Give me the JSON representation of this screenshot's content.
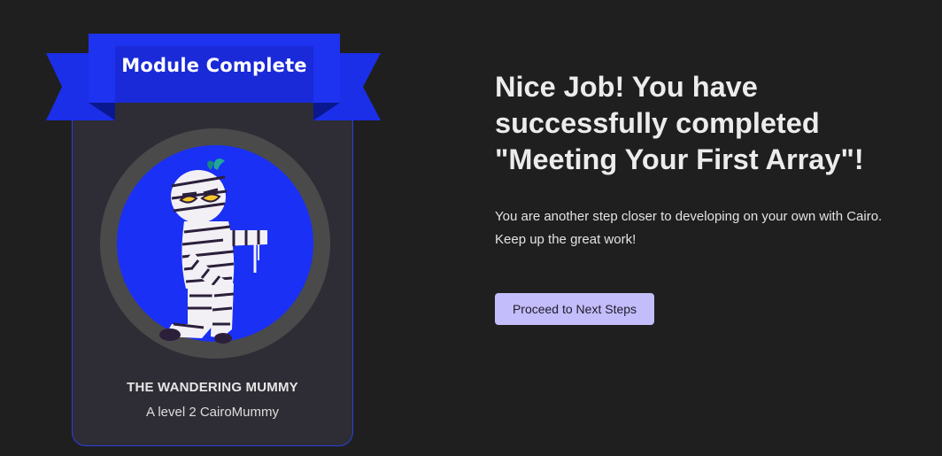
{
  "badge": {
    "ribbon_title": "Module Complete",
    "character_name": "THE WANDERING MUMMY",
    "character_level": "A level 2 CairoMummy"
  },
  "message": {
    "headline_lines": [
      "Nice Job! You have",
      "successfully completed",
      "\"Meeting Your First Array\"!"
    ],
    "body_lines": [
      "You are another step closer to developing on your own with Cairo.",
      "Keep up the great work!"
    ]
  },
  "actions": {
    "proceed_label": "Proceed to Next Steps"
  },
  "colors": {
    "background": "#1f1f1f",
    "card": "#2e2d35",
    "ribbon": "#1e33f0",
    "portrait_ring": "#4a4a4a",
    "portrait_fill": "#1a30f5",
    "button": "#c4bdfb"
  },
  "icons": {
    "portrait": "mummy-character-icon"
  }
}
